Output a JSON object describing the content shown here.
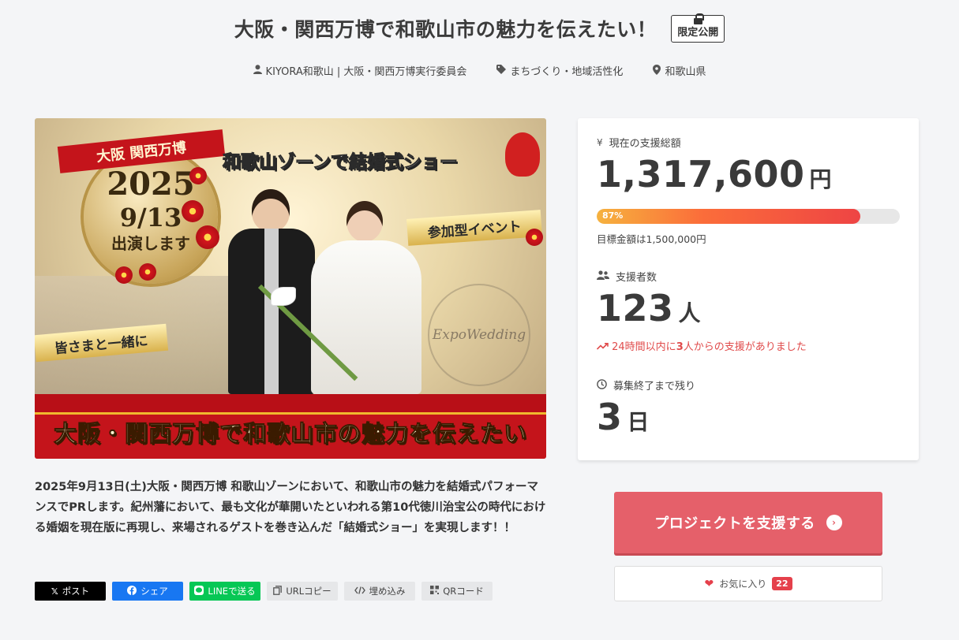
{
  "header": {
    "title": "大阪・関西万博で和歌山市の魅力を伝えたい！",
    "badge": "限定公開",
    "owner": "KIYORA和歌山 | 大阪・関西万博実行委員会",
    "category": "まちづくり・地域活性化",
    "location": "和歌山県"
  },
  "hero": {
    "ribbon": "大阪 関西万博",
    "year": "2025",
    "date": "9/13",
    "appear": "出演します",
    "headline": "和歌山ゾーンで結婚式ショー",
    "tag_event": "参加型イベント",
    "tag_together": "皆さまと一緒に",
    "crest_text": "ExpoWedding",
    "band_text": "大阪・関西万博で和歌山市の魅力を伝えたい"
  },
  "description": "2025年9月13日(土)大阪・関西万博 和歌山ゾーンにおいて、和歌山市の魅力を結婚式パフォーマンスでPRします。紀州藩において、最も文化が華開いたといわれる第10代徳川治宝公の時代における婚姻を現在版に再現し、来場されるゲストを巻き込んだ「結婚式ショー」を実現します！！",
  "share": {
    "x": "ポスト",
    "facebook": "シェア",
    "line": "LINEで送る",
    "url": "URLコピー",
    "embed": "埋め込み",
    "qr": "QRコード"
  },
  "stats": {
    "total_label": "現在の支援総額",
    "total_amount": "1,317,600",
    "total_unit": "円",
    "progress_percent": 87,
    "progress_label": "87%",
    "goal_text": "目標金額は1,500,000円",
    "backers_label": "支援者数",
    "backers_count": "123",
    "backers_unit": "人",
    "trend_prefix": "24時間以内に",
    "trend_number": "3",
    "trend_suffix": "人からの支援がありました",
    "remaining_label": "募集終了まで残り",
    "remaining_days": "3",
    "remaining_unit": "日"
  },
  "actions": {
    "support_label": "プロジェクトを支援する",
    "favorite_label": "お気に入り",
    "favorite_count": "22"
  },
  "colors": {
    "support_button": "#e5606a",
    "trend_red": "#e04b4b",
    "line_green": "#06c755",
    "facebook_blue": "#1877f2"
  }
}
